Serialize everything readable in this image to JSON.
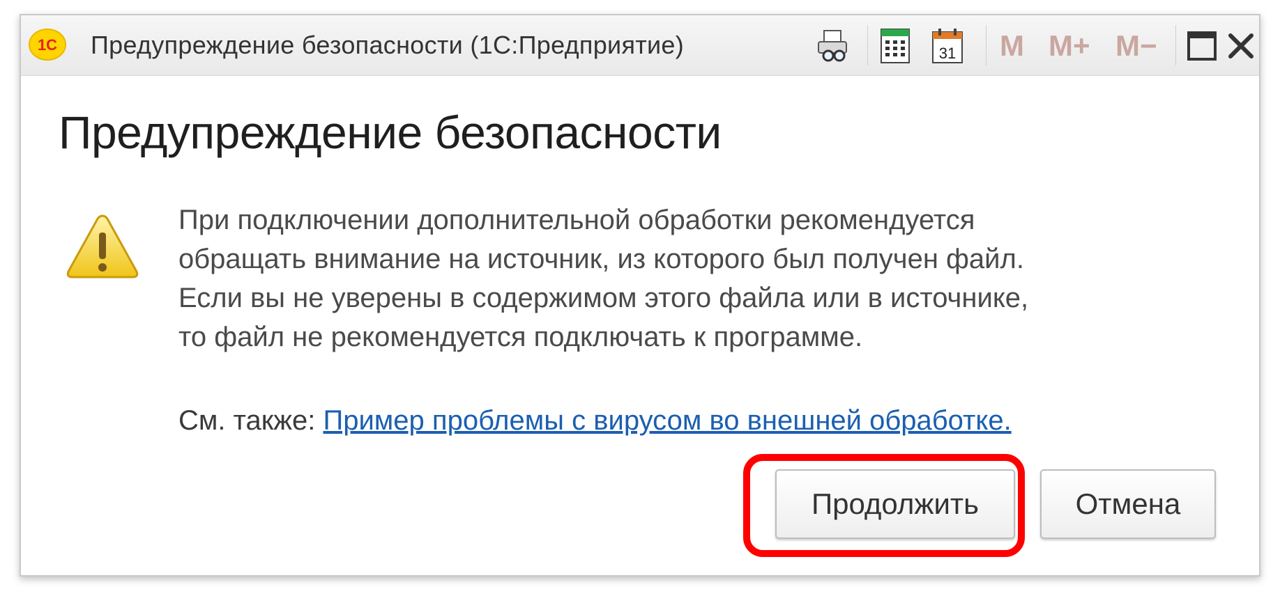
{
  "window": {
    "title": "Предупреждение безопасности  (1С:Предприятие)",
    "logo_text": "1С",
    "toolbar": {
      "icons": [
        "print-preview-icon",
        "calculator-icon",
        "calendar-icon"
      ],
      "calendar_day": "31",
      "memory_buttons": [
        "M",
        "M+",
        "M−"
      ]
    }
  },
  "dialog": {
    "heading": "Предупреждение безопасности",
    "icon": "warning-icon",
    "message_lines": [
      "При подключении дополнительной обработки рекомендуется",
      "обращать внимание на источник, из которого был получен файл.",
      "Если вы не уверены в содержимом этого файла или в источнике,",
      "то файл не рекомендуется подключать к программе."
    ],
    "see_also_label": "См. также: ",
    "see_also_link": "Пример проблемы с вирусом во внешней обработке.",
    "buttons": {
      "continue": "Продолжить",
      "cancel": "Отмена"
    }
  },
  "colors": {
    "link": "#1b5fb0",
    "highlight": "#ff0000",
    "warning_fill": "#f5d84a",
    "logo_fill": "#ffd400",
    "logo_text": "#e1251b"
  }
}
